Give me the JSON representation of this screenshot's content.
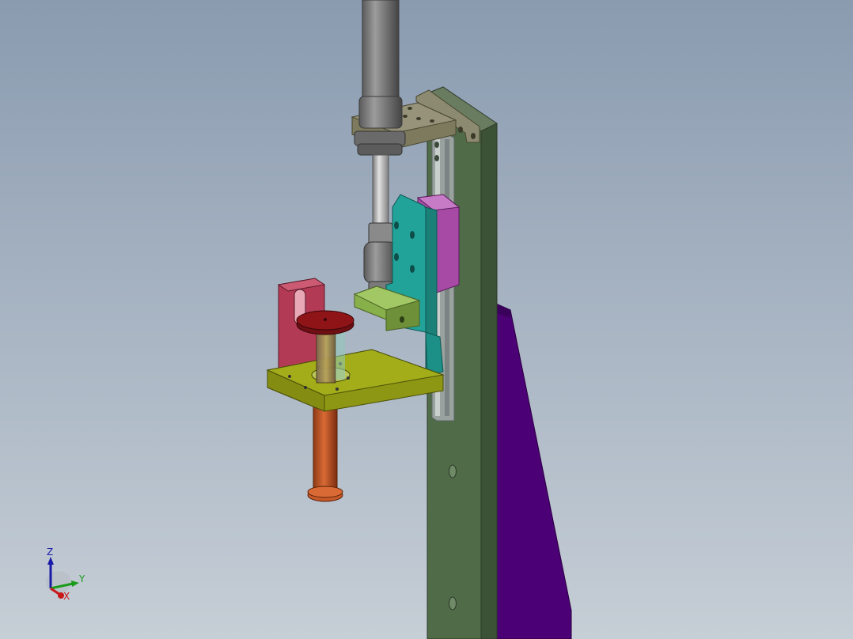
{
  "viewport": {
    "background_top": "#8a9bb0",
    "background_bottom": "#c6ced6"
  },
  "model": {
    "parts": [
      {
        "name": "air-cylinder",
        "color": "#7a7a7a"
      },
      {
        "name": "cylinder-mount-bracket",
        "color": "#7d7a5e"
      },
      {
        "name": "vertical-column",
        "color": "#4f6b48"
      },
      {
        "name": "linear-guide-rail",
        "color": "#9aa2a0"
      },
      {
        "name": "slider-block",
        "color": "#a64aa6"
      },
      {
        "name": "carriage-plate",
        "color": "#22a39a"
      },
      {
        "name": "rod-connector-bracket",
        "color": "#88b04a"
      },
      {
        "name": "support-plate",
        "color": "#a3ad1a"
      },
      {
        "name": "side-bracket",
        "color": "#b33a55"
      },
      {
        "name": "spool-flange-top",
        "color": "#8f1418"
      },
      {
        "name": "spool-shaft",
        "color": "#c85a2a"
      },
      {
        "name": "gusset-plate",
        "color": "#4b0075"
      }
    ]
  },
  "triad": {
    "z_label": "Z",
    "y_label": "Y",
    "x_label": "X",
    "z_color": "#1a1aa8",
    "y_color": "#1a9a1a",
    "x_color": "#c81818"
  }
}
